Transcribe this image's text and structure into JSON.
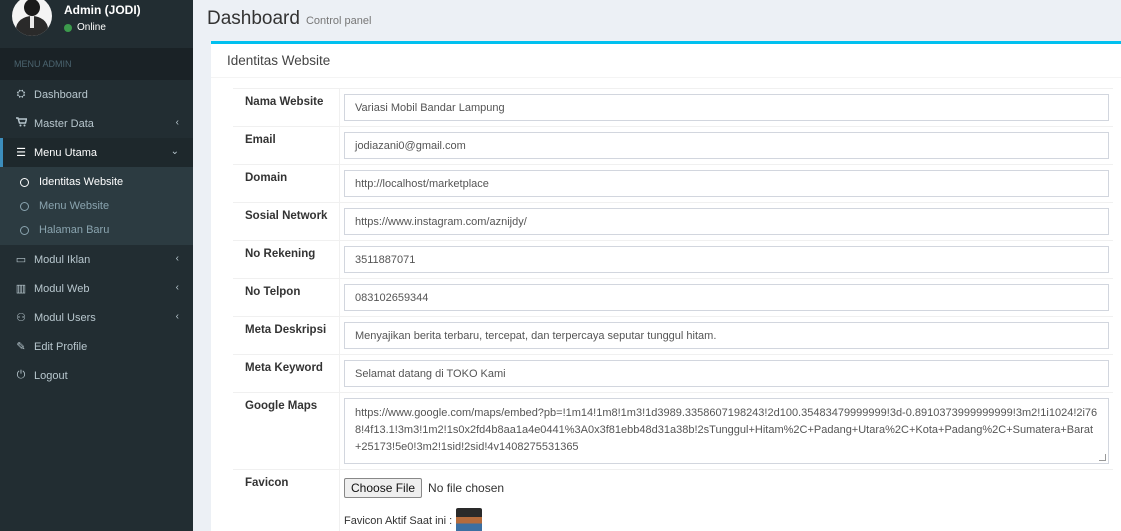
{
  "user": {
    "name": "Admin (JODI)",
    "status": "Online"
  },
  "menu": {
    "header": "MENU ADMIN",
    "items": [
      {
        "label": "Dashboard",
        "icon": "dashboard-icon",
        "glyph": "⛭"
      },
      {
        "label": "Master Data",
        "icon": "cart-icon",
        "glyph": "🛒"
      },
      {
        "label": "Menu Utama",
        "icon": "list-icon",
        "glyph": "☰"
      },
      {
        "label": "Modul Iklan",
        "icon": "tv-icon",
        "glyph": "▭"
      },
      {
        "label": "Modul Web",
        "icon": "chart-icon",
        "glyph": "▥"
      },
      {
        "label": "Modul Users",
        "icon": "users-icon",
        "glyph": "⚇"
      },
      {
        "label": "Edit Profile",
        "icon": "edit-icon",
        "glyph": "✎"
      },
      {
        "label": "Logout",
        "icon": "power-icon",
        "glyph": "⏻"
      }
    ],
    "submenu": [
      "Identitas Website",
      "Menu Website",
      "Halaman Baru"
    ]
  },
  "header": {
    "title": "Dashboard",
    "subtitle": "Control panel"
  },
  "box": {
    "title": "Identitas Website"
  },
  "form": {
    "nama_website": {
      "label": "Nama Website",
      "value": "Variasi Mobil Bandar Lampung"
    },
    "email": {
      "label": "Email",
      "value": "jodiazani0@gmail.com"
    },
    "domain": {
      "label": "Domain",
      "value": "http://localhost/marketplace"
    },
    "sosial": {
      "label": "Sosial Network",
      "value": "https://www.instagram.com/aznijdy/"
    },
    "rekening": {
      "label": "No Rekening",
      "value": "3511887071"
    },
    "telpon": {
      "label": "No Telpon",
      "value": "083102659344"
    },
    "meta_deskripsi": {
      "label": "Meta Deskripsi",
      "value": "Menyajikan berita terbaru, tercepat, dan terpercaya seputar tunggul hitam."
    },
    "meta_keyword": {
      "label": "Meta Keyword",
      "value": "Selamat datang di TOKO Kami"
    },
    "google_maps": {
      "label": "Google Maps",
      "value": "https://www.google.com/maps/embed?pb=!1m14!1m8!1m3!1d3989.3358607198243!2d100.35483479999999!3d-0.8910373999999999!3m2!1i1024!2i768!4f13.1!3m3!1m2!1s0x2fd4b8aa1a4e0441%3A0x3f81ebb48d31a38b!2sTunggul+Hitam%2C+Padang+Utara%2C+Kota+Padang%2C+Sumatera+Barat+25173!5e0!3m2!1sid!2sid!4v1408275531365"
    },
    "favicon": {
      "label": "Favicon",
      "button": "Choose File",
      "no_file": "No file chosen",
      "active_label": "Favicon Aktif Saat ini :"
    }
  }
}
